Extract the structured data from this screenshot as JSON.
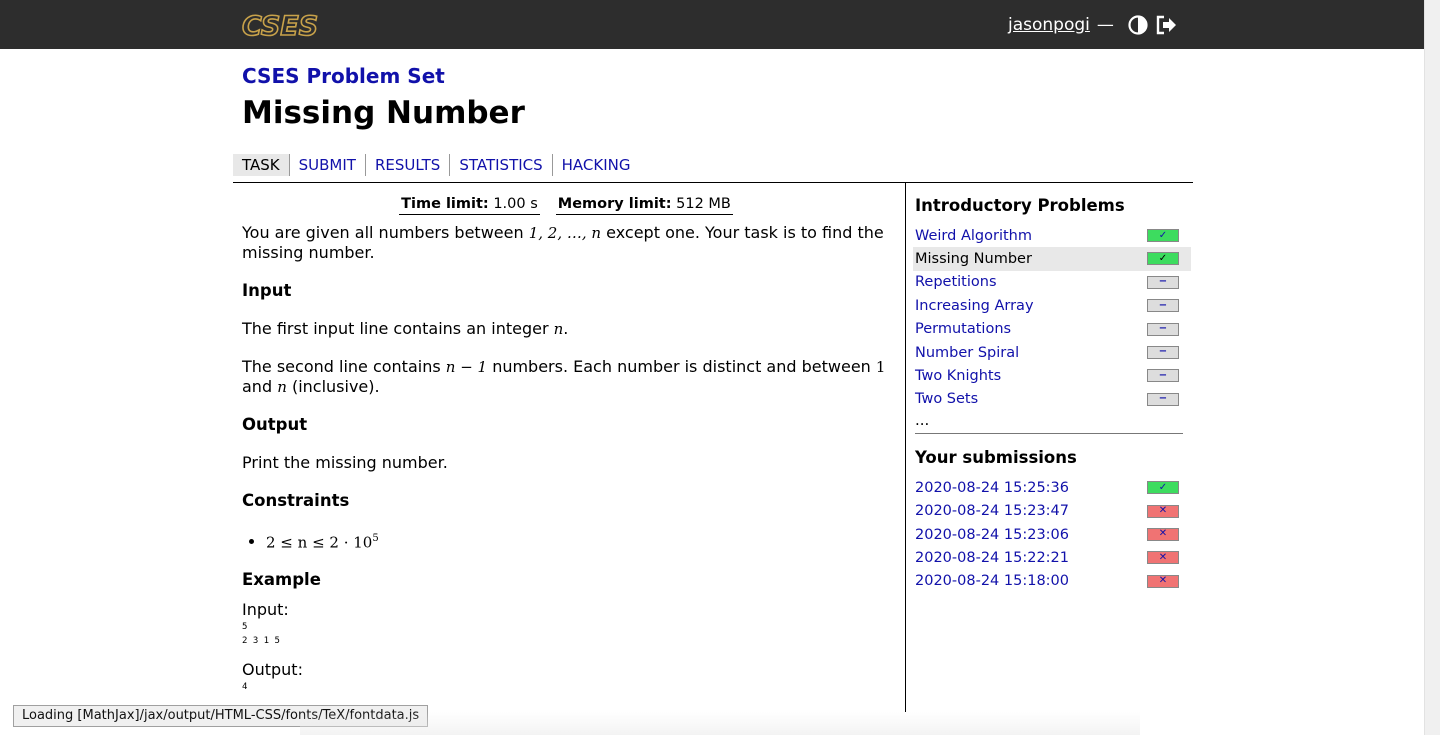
{
  "header": {
    "logo_text": "CSES",
    "username": "jasonpogi",
    "separator": "—",
    "theme_icon": "contrast-icon",
    "logout_icon": "logout-icon"
  },
  "breadcrumb": "CSES Problem Set",
  "title": "Missing Number",
  "tabs": [
    {
      "label": "TASK",
      "active": true
    },
    {
      "label": "SUBMIT"
    },
    {
      "label": "RESULTS"
    },
    {
      "label": "STATISTICS"
    },
    {
      "label": "HACKING"
    }
  ],
  "task": {
    "time_label": "Time limit:",
    "time_value": "1.00 s",
    "memory_label": "Memory limit:",
    "memory_value": "512 MB",
    "intro_a": "You are given all numbers between",
    "intro_math": "1, 2, …, n",
    "intro_b": "except one. Your task is to find the missing number.",
    "input_heading": "Input",
    "input_p1_a": "The first input line contains an integer",
    "input_p1_math": "n",
    "input_p1_b": ".",
    "input_p2_a": "The second line contains",
    "input_p2_math": "n − 1",
    "input_p2_b": "numbers. Each number is distinct and between",
    "input_p2_math2": "1",
    "input_p2_c": "and",
    "input_p2_math3": "n",
    "input_p2_d": "(inclusive).",
    "output_heading": "Output",
    "output_p": "Print the missing number.",
    "constraints_heading": "Constraints",
    "constraint_main": "2 ≤ n ≤ 2 · 10",
    "constraint_exp": "5",
    "example_heading": "Example",
    "input_label": "Input:",
    "input_sample": "5\n2 3 1 5",
    "output_label": "Output:",
    "output_sample": "4"
  },
  "sidebar": {
    "section_title": "Introductory Problems",
    "problems": [
      {
        "name": "Weird Algorithm",
        "status": "ok",
        "current": false
      },
      {
        "name": "Missing Number",
        "status": "ok",
        "current": true
      },
      {
        "name": "Repetitions",
        "status": "none",
        "current": false
      },
      {
        "name": "Increasing Array",
        "status": "none",
        "current": false
      },
      {
        "name": "Permutations",
        "status": "none",
        "current": false
      },
      {
        "name": "Number Spiral",
        "status": "none",
        "current": false
      },
      {
        "name": "Two Knights",
        "status": "none",
        "current": false
      },
      {
        "name": "Two Sets",
        "status": "none",
        "current": false
      }
    ],
    "more": "...",
    "submissions_title": "Your submissions",
    "submissions": [
      {
        "time": "2020-08-24 15:25:36",
        "status": "ok"
      },
      {
        "time": "2020-08-24 15:23:47",
        "status": "fail"
      },
      {
        "time": "2020-08-24 15:23:06",
        "status": "fail"
      },
      {
        "time": "2020-08-24 15:22:21",
        "status": "fail"
      },
      {
        "time": "2020-08-24 15:18:00",
        "status": "fail"
      }
    ],
    "badge_symbols": {
      "ok": "✓",
      "none": "−",
      "fail": "✕"
    }
  },
  "status_bar": "Loading [MathJax]/jax/output/HTML-CSS/fonts/TeX/fontdata.js",
  "colors": {
    "link": "#1111aa",
    "header_bg": "#2d2d2d",
    "logo": "#c8a24a",
    "ok": "#3ddc5f",
    "fail": "#f07373",
    "none": "#dddddd"
  }
}
